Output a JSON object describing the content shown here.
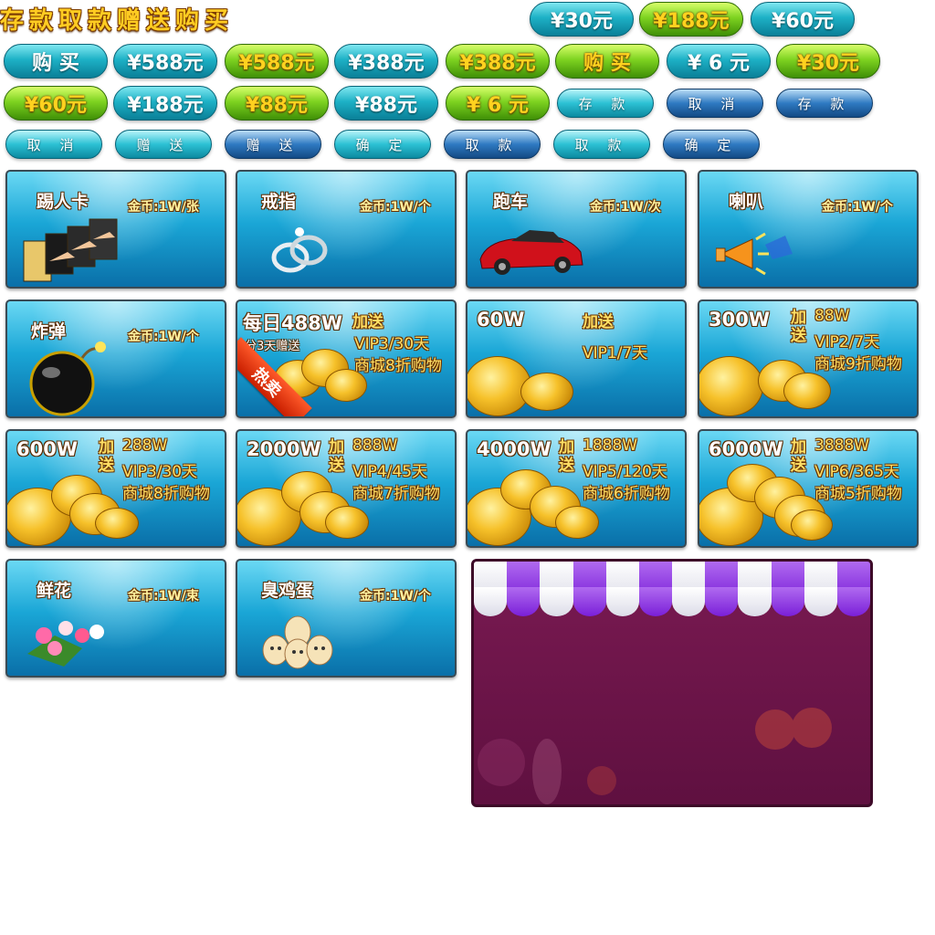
{
  "title": {
    "text": "存款取款赠送购买"
  },
  "buttons_row1": [
    {
      "label": "¥30元",
      "style": "teal"
    },
    {
      "label": "¥188元",
      "style": "green"
    },
    {
      "label": "¥60元",
      "style": "teal"
    }
  ],
  "buttons_row2": [
    {
      "label": "购 买",
      "style": "teal"
    },
    {
      "label": "¥588元",
      "style": "teal"
    },
    {
      "label": "¥588元",
      "style": "green"
    },
    {
      "label": "¥388元",
      "style": "teal"
    },
    {
      "label": "¥388元",
      "style": "green"
    },
    {
      "label": "购 买",
      "style": "green"
    },
    {
      "label": "¥ 6 元",
      "style": "teal"
    },
    {
      "label": "¥30元",
      "style": "green"
    }
  ],
  "buttons_row3": [
    {
      "label": "¥60元",
      "style": "green"
    },
    {
      "label": "¥188元",
      "style": "teal"
    },
    {
      "label": "¥88元",
      "style": "green"
    },
    {
      "label": "¥88元",
      "style": "teal"
    },
    {
      "label": "¥ 6 元",
      "style": "green"
    },
    {
      "label": "存 款",
      "style": "teal"
    },
    {
      "label": "取 消",
      "style": "navy"
    },
    {
      "label": "存 款",
      "style": "navy"
    }
  ],
  "buttons_row4": [
    {
      "label": "取 消",
      "style": "teal"
    },
    {
      "label": "赠 送",
      "style": "teal"
    },
    {
      "label": "赠 送",
      "style": "navy"
    },
    {
      "label": "确 定",
      "style": "teal"
    },
    {
      "label": "取 款",
      "style": "navy"
    },
    {
      "label": "取 款",
      "style": "teal"
    },
    {
      "label": "确 定",
      "style": "navy"
    }
  ],
  "items": [
    {
      "name": "踢人卡",
      "price": "金币:1W/张"
    },
    {
      "name": "戒指",
      "price": "金币:1W/个"
    },
    {
      "name": "跑车",
      "price": "金币:1W/次"
    },
    {
      "name": "喇叭",
      "price": "金币:1W/个"
    },
    {
      "name": "炸弹",
      "price": "金币:1W/个"
    },
    {
      "name": "鲜花",
      "price": "金币:1W/束"
    },
    {
      "name": "臭鸡蛋",
      "price": "金币:1W/个"
    }
  ],
  "packages": [
    {
      "amount": "每日488W",
      "add": "加送",
      "lines": [
        "VIP3/30天",
        "商城8折购物"
      ],
      "sub": "分3天赠送",
      "badge": "热卖"
    },
    {
      "amount": "60W",
      "add": "加送",
      "lines": [
        "VIP1/7天"
      ]
    },
    {
      "amount": "300W",
      "add": "加送",
      "lines": [
        "88W",
        "VIP2/7天",
        "商城9折购物"
      ]
    },
    {
      "amount": "600W",
      "add": "加送",
      "lines": [
        "288W",
        "VIP3/30天",
        "商城8折购物"
      ]
    },
    {
      "amount": "2000W",
      "add": "加送",
      "lines": [
        "888W",
        "VIP4/45天",
        "商城7折购物"
      ]
    },
    {
      "amount": "4000W",
      "add": "加送",
      "lines": [
        "1888W",
        "VIP5/120天",
        "商城6折购物"
      ]
    },
    {
      "amount": "6000W",
      "add": "加送",
      "lines": [
        "3888W",
        "VIP6/365天",
        "商城5折购物"
      ]
    }
  ]
}
